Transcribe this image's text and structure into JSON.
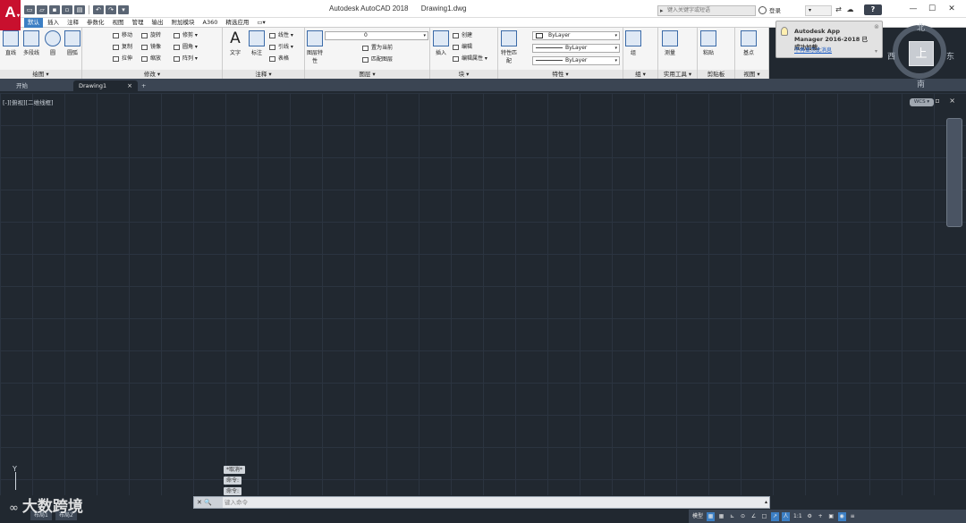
{
  "app": {
    "logo": "A",
    "title": "Autodesk AutoCAD 2018",
    "document": "Drawing1.dwg"
  },
  "quick_access": [
    "new-icon",
    "open-icon",
    "save-icon",
    "saveas-icon",
    "print-icon",
    "undo-icon",
    "redo-icon",
    "dropdown-icon"
  ],
  "search": {
    "placeholder": "键入关键字或短语"
  },
  "signin": {
    "label": "登录"
  },
  "ribbon_tabs": [
    "默认",
    "插入",
    "注释",
    "参数化",
    "视图",
    "管理",
    "输出",
    "附加模块",
    "A360",
    "精选应用"
  ],
  "active_tab": "默认",
  "panels": {
    "draw": {
      "title": "绘图 ▾",
      "line": "直线",
      "polyline": "多段线",
      "circle": "圆",
      "arc": "圆弧"
    },
    "modify": {
      "title": "修改 ▾",
      "move": "移动",
      "rotate": "旋转",
      "trim": "修剪 ▾",
      "copy": "复制",
      "mirror": "镜像",
      "fillet": "圆角 ▾",
      "stretch": "拉伸",
      "scale": "缩放",
      "array": "阵列 ▾"
    },
    "annotation": {
      "title": "注释 ▾",
      "text": "文字",
      "dim": "标注",
      "linear": "线性 ▾",
      "leader": "引线 ▾",
      "table": "表格"
    },
    "layers": {
      "title": "图层 ▾",
      "props": "图层特性",
      "current_layer": "0",
      "make_current": "置为当前",
      "match": "匹配图层"
    },
    "block": {
      "title": "块 ▾",
      "insert": "插入",
      "create": "创建",
      "edit": "编辑",
      "edit_attr": "编辑属性 ▾"
    },
    "properties": {
      "title": "特性 ▾",
      "match": "特性匹配",
      "color": "ByLayer",
      "linetype": "ByLayer",
      "lineweight": "ByLayer"
    },
    "groups": {
      "title": "组 ▾",
      "group": "组"
    },
    "utilities": {
      "title": "实用工具 ▾",
      "measure": "测量"
    },
    "clipboard": {
      "title": "剪贴板",
      "paste": "粘贴"
    },
    "view": {
      "title": "视图 ▾",
      "base": "基点"
    }
  },
  "notification": {
    "title": "Autodesk App Manager 2016-2018 已成功加载。",
    "link": "不再显示此消息"
  },
  "doc_tabs": [
    "开始",
    "Drawing1"
  ],
  "doc_tab_add": "+",
  "viewport": {
    "label": "[-][俯视][二维线框]",
    "controls": "− ▫ ×"
  },
  "viewcube": {
    "face": "上",
    "north": "北",
    "south": "南",
    "east": "东",
    "west": "西",
    "wcs": "WCS ▾"
  },
  "ucs": {
    "y": "Y"
  },
  "command_history": [
    "*取消*",
    "命令:",
    "命令:"
  ],
  "command": {
    "buttons": "✕ 🔍",
    "placeholder": "键入命令",
    "dropdown": "▴"
  },
  "layout_tabs": [
    "布局1",
    "布局2"
  ],
  "status": [
    "模型",
    "▦",
    "▦",
    "⊾",
    "⊙",
    "∠",
    "□",
    "↗",
    "人",
    "1:1",
    "⚙",
    "+",
    "▣",
    "◉",
    "≡"
  ],
  "watermark": {
    "logo": "∞",
    "text": "大数跨境"
  }
}
